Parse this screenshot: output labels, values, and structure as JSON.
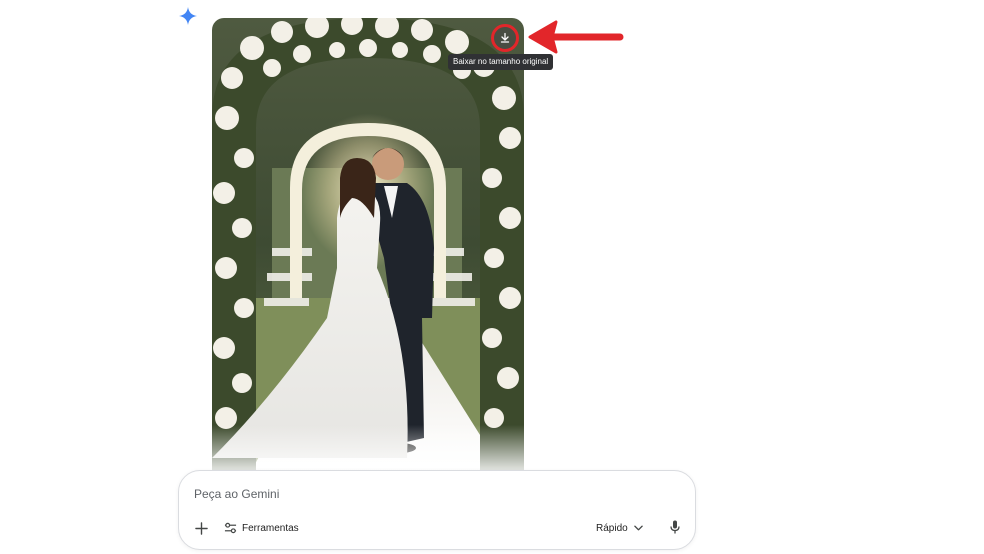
{
  "icons": {
    "gemini": "gemini-sparkle-icon",
    "download": "download-icon",
    "plus": "plus-icon",
    "tools": "sliders-icon",
    "chevron": "chevron-down-icon",
    "mic": "microphone-icon",
    "arrow": "red-arrow-annotation"
  },
  "colors": {
    "gemini_blue": "#4285f4",
    "annotation_red": "#e2262a",
    "tooltip_bg": "#303134"
  },
  "image": {
    "tooltip": "Baixar no tamanho original"
  },
  "prompt": {
    "placeholder": "Peça ao Gemini",
    "value": ""
  },
  "toolbar": {
    "tools_label": "Ferramentas",
    "mode_label": "Rápido"
  }
}
